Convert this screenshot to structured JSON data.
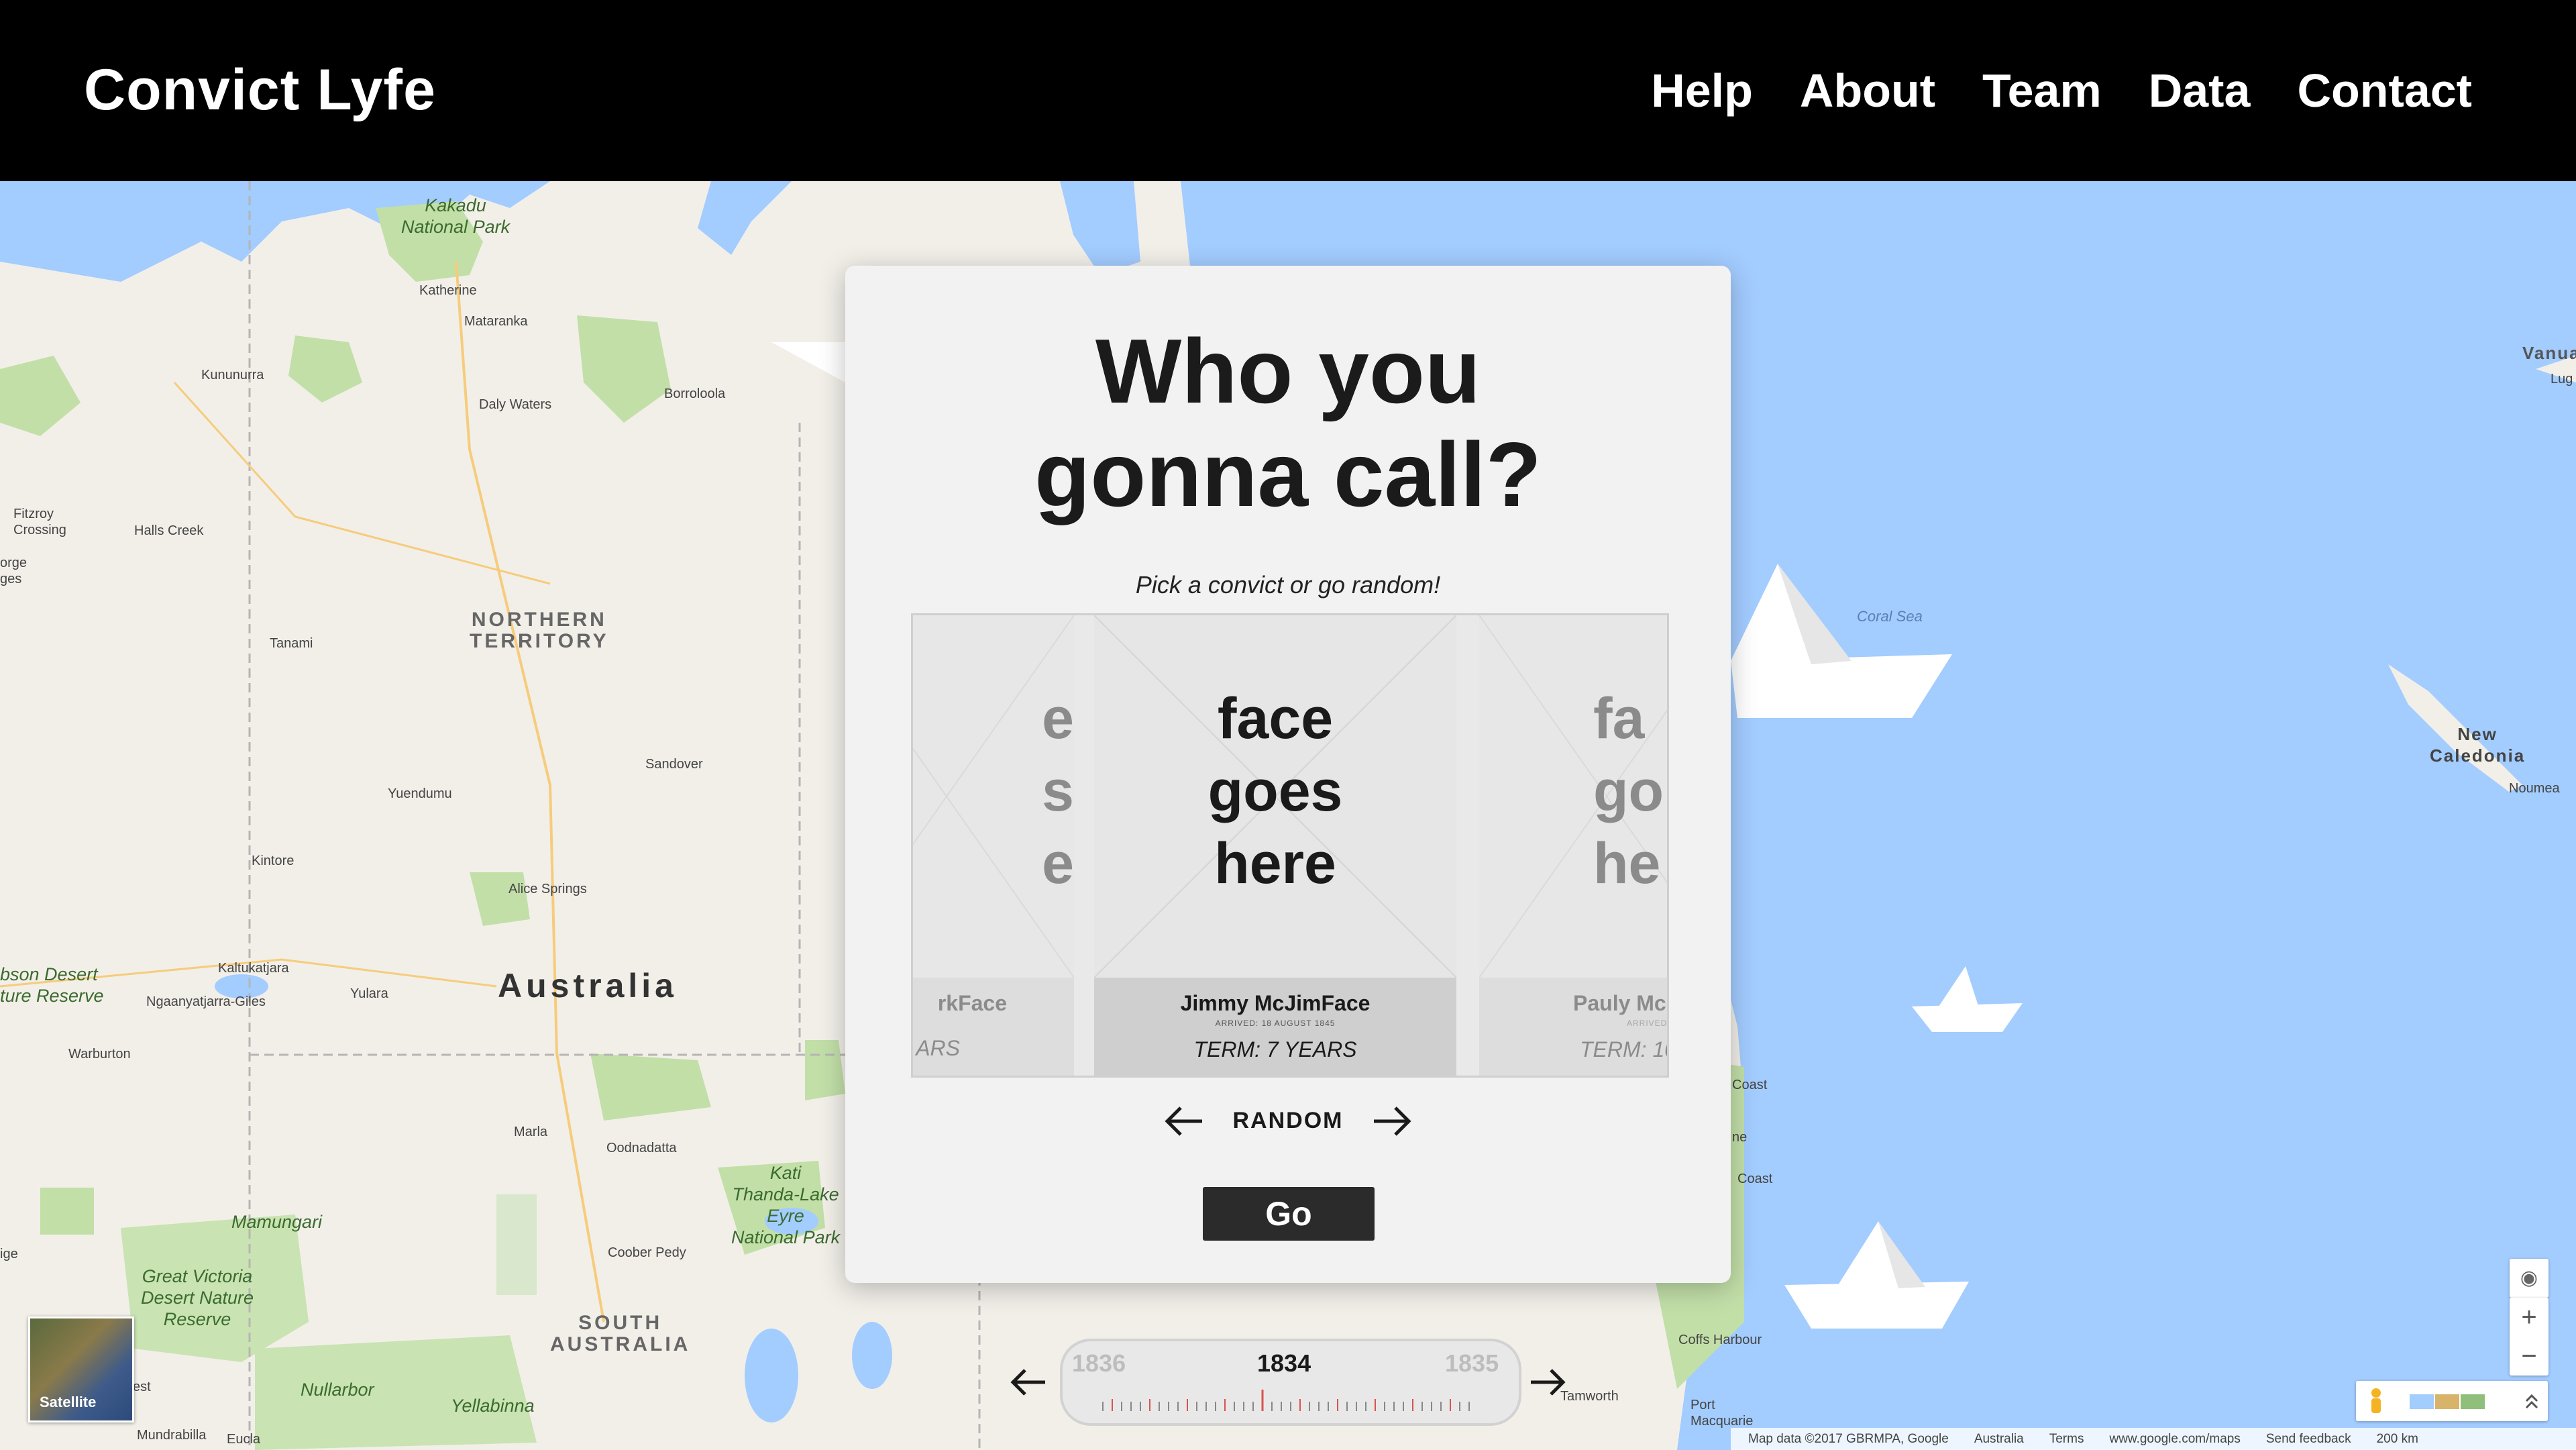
{
  "header": {
    "brand": "Convict Lyfe",
    "nav": [
      "Help",
      "About",
      "Team",
      "Data",
      "Contact"
    ]
  },
  "map": {
    "labels": {
      "kakadu": "Kakadu\nNational Park",
      "katherine": "Katherine",
      "mataranka": "Mataranka",
      "kununurra": "Kununurra",
      "daly_waters": "Daly Waters",
      "borroloola": "Borroloola",
      "fitzroy": "Fitzroy\nCrossing",
      "halls_creek": "Halls Creek",
      "orge": "orge",
      "ges": "ges",
      "northern_territory": "NORTHERN\nTERRITORY",
      "tanami": "Tanami",
      "sandover": "Sandover",
      "yuendumu": "Yuendumu",
      "kintore": "Kintore",
      "alice_springs": "Alice Springs",
      "gibson": "bson Desert\nture Reserve",
      "kaltukatjara": "Kaltukatjara",
      "ngaanyatjarra": "Ngaanyatjarra-Giles",
      "yulara": "Yulara",
      "australia": "Australia",
      "warburton": "Warburton",
      "marla": "Marla",
      "oodnadatta": "Oodnadatta",
      "kati": "Kati\nThanda-Lake\nEyre\nNational Park",
      "mamungari": "Mamungari",
      "coober_pedy": "Coober Pedy",
      "great_victoria": "Great Victoria\nDesert Nature\nReserve",
      "south_australia": "SOUTH\nAUSTRALIA",
      "nullarbor": "Nullarbor",
      "yellabinna": "Yellabinna",
      "mundrabilla": "Mundrabilla",
      "eucla": "Eucla",
      "est": "est",
      "ige": "ige",
      "coral_sea": "Coral Sea",
      "vanua": "Vanua",
      "lug": "Lug",
      "new_caledonia": "New\nCaledonia",
      "noumea": "Noumea",
      "coast1": "Coast",
      "ne": "ne",
      "coast2": "Coast",
      "coffs_harbour": "Coffs Harbour",
      "port_macquarie": "Port\nMacquarie",
      "tamworth": "Tamworth"
    },
    "satellite_label": "Satellite",
    "footer": [
      "Map data ©2017 GBRMPA, Google",
      "Australia",
      "Terms",
      "www.google.com/maps",
      "Send feedback",
      "200 km"
    ],
    "zoom_in": "+",
    "zoom_out": "−"
  },
  "modal": {
    "title_line1": "Who you",
    "title_line2": "gonna call?",
    "subtitle": "Pick a convict or go random!",
    "cards": [
      {
        "face": "face\ngoes\nhere",
        "name": "Jimmy McJimFace",
        "arrived": "ARRIVED: 18 AUGUST 1845",
        "term": "TERM: 7 YEARS"
      },
      {
        "face": "e\ns\ne",
        "name": "rkFace",
        "arrived": "",
        "term": "ARS"
      },
      {
        "face": "fa\ngo\nhe",
        "name": "Pauly Mc",
        "arrived": "ARRIVED",
        "term": "TERM: 10"
      }
    ],
    "random_label": "RANDOM",
    "go_label": "Go"
  },
  "timeline": {
    "prev_year": "1836",
    "current_year": "1834",
    "next_year": "1835"
  }
}
